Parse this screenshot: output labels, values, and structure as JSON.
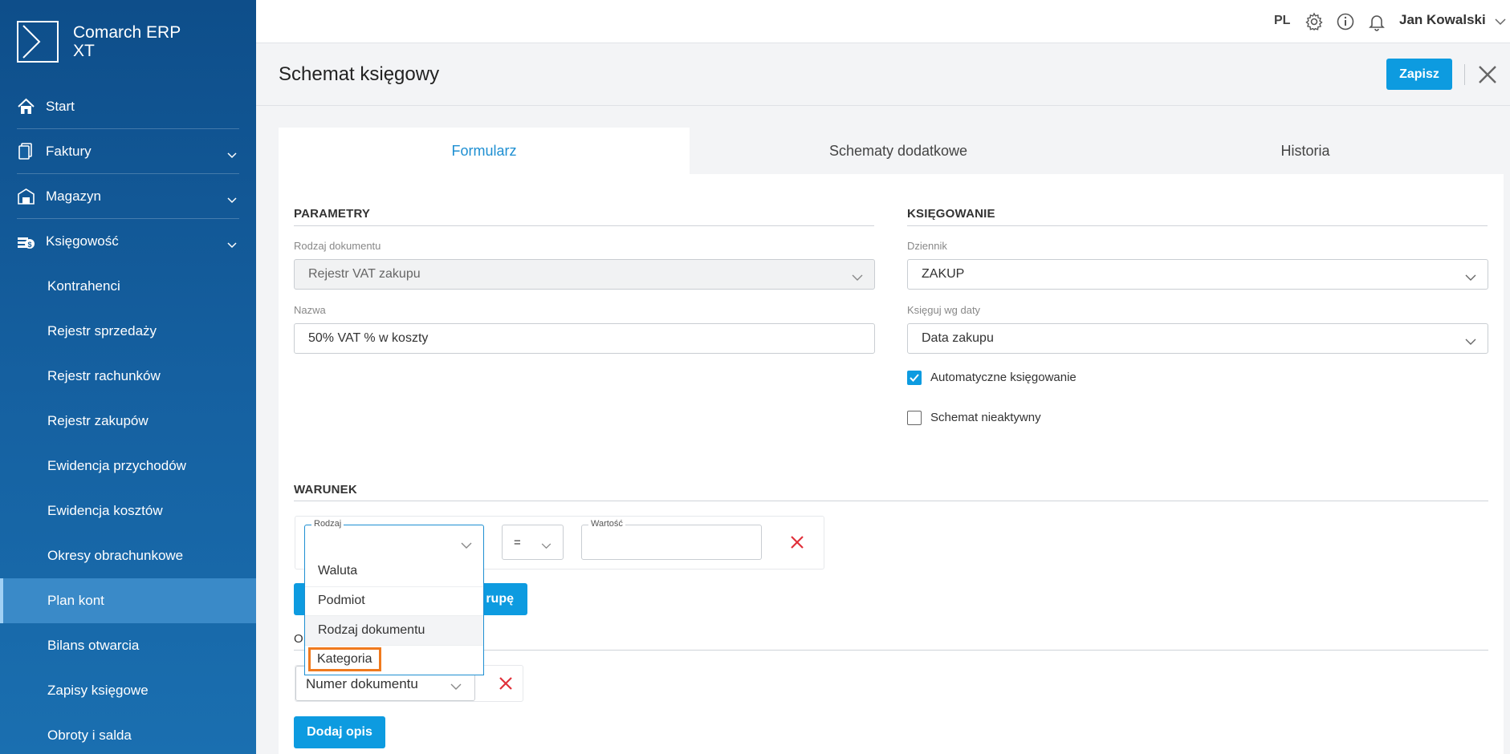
{
  "app": {
    "name": "Comarch ERP XT"
  },
  "sidebar": {
    "items": [
      {
        "label": "Start",
        "icon": "home-icon"
      },
      {
        "label": "Faktury",
        "icon": "documents-icon"
      },
      {
        "label": "Magazyn",
        "icon": "warehouse-icon"
      },
      {
        "label": "Księgowość",
        "icon": "accounting-icon"
      }
    ],
    "subitems": [
      {
        "label": "Kontrahenci"
      },
      {
        "label": "Rejestr sprzedaży"
      },
      {
        "label": "Rejestr rachunków"
      },
      {
        "label": "Rejestr zakupów"
      },
      {
        "label": "Ewidencja przychodów"
      },
      {
        "label": "Ewidencja kosztów"
      },
      {
        "label": "Okresy obrachunkowe"
      },
      {
        "label": "Plan kont"
      },
      {
        "label": "Bilans otwarcia"
      },
      {
        "label": "Zapisy księgowe"
      },
      {
        "label": "Obroty i salda"
      }
    ],
    "active_subitem": "Plan kont"
  },
  "topbar": {
    "language": "PL",
    "user_name": "Jan Kowalski"
  },
  "header": {
    "title": "Schemat księgowy",
    "save_label": "Zapisz"
  },
  "tabs": [
    {
      "label": "Formularz",
      "active": true
    },
    {
      "label": "Schematy dodatkowe",
      "active": false
    },
    {
      "label": "Historia",
      "active": false
    }
  ],
  "parametry": {
    "title": "PARAMETRY",
    "doc_type_label": "Rodzaj dokumentu",
    "doc_type_value": "Rejestr VAT zakupu",
    "name_label": "Nazwa",
    "name_value": "50% VAT % w koszty"
  },
  "ksiegowanie": {
    "title": "KSIĘGOWANIE",
    "journal_label": "Dziennik",
    "journal_value": "ZAKUP",
    "date_label": "Księguj wg daty",
    "date_value": "Data zakupu",
    "auto_label": "Automatyczne księgowanie",
    "auto_checked": true,
    "inactive_label": "Schemat nieaktywny",
    "inactive_checked": false
  },
  "warunek": {
    "title": "WARUNEK",
    "kind_label": "Rodzaj",
    "operator_value": "=",
    "value_label": "Wartość",
    "value_value": "",
    "add_group_partial": "rupę"
  },
  "dropdown": {
    "options": [
      "Waluta",
      "Podmiot",
      "Rodzaj dokumentu",
      "Kategoria"
    ],
    "hovered": "Rodzaj dokumentu",
    "highlighted": "Kategoria"
  },
  "opis": {
    "title_partial": "O",
    "field_value": "Numer dokumentu",
    "add_label": "Dodaj opis"
  },
  "colors": {
    "accent": "#0d9be0",
    "sidebar": "#1560a0",
    "highlight": "#f07a1e",
    "delete": "#e0303a"
  }
}
